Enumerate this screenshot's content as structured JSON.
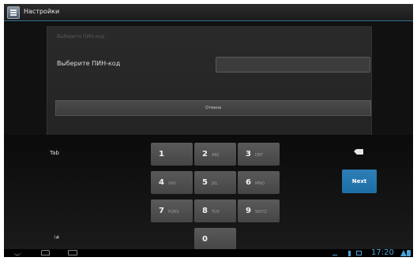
{
  "actionbar": {
    "title": "Настройки",
    "icon": "settings-icon"
  },
  "dialog": {
    "header": "Выберите ПИН-код",
    "label": "Выберите ПИН-код",
    "pin_value": "",
    "cancel_label": "Отмена"
  },
  "keyboard": {
    "tab_label": "Tab",
    "symbol_label": "!#",
    "next_label": "Next",
    "backspace_icon": "backspace-icon",
    "keys": [
      {
        "digit": "1",
        "letters": ""
      },
      {
        "digit": "2",
        "letters": "ABC"
      },
      {
        "digit": "3",
        "letters": "DEF"
      },
      {
        "digit": "4",
        "letters": "GHI"
      },
      {
        "digit": "5",
        "letters": "JKL"
      },
      {
        "digit": "6",
        "letters": "MNO"
      },
      {
        "digit": "7",
        "letters": "PQRS"
      },
      {
        "digit": "8",
        "letters": "TUV"
      },
      {
        "digit": "9",
        "letters": "WXYZ"
      },
      {
        "digit": "0",
        "letters": ""
      }
    ]
  },
  "systembar": {
    "clock": "17:20",
    "accent": "#4aa3d8"
  },
  "colors": {
    "next_key": "#2476ae",
    "actionbar_divider": "#3a7da0"
  }
}
